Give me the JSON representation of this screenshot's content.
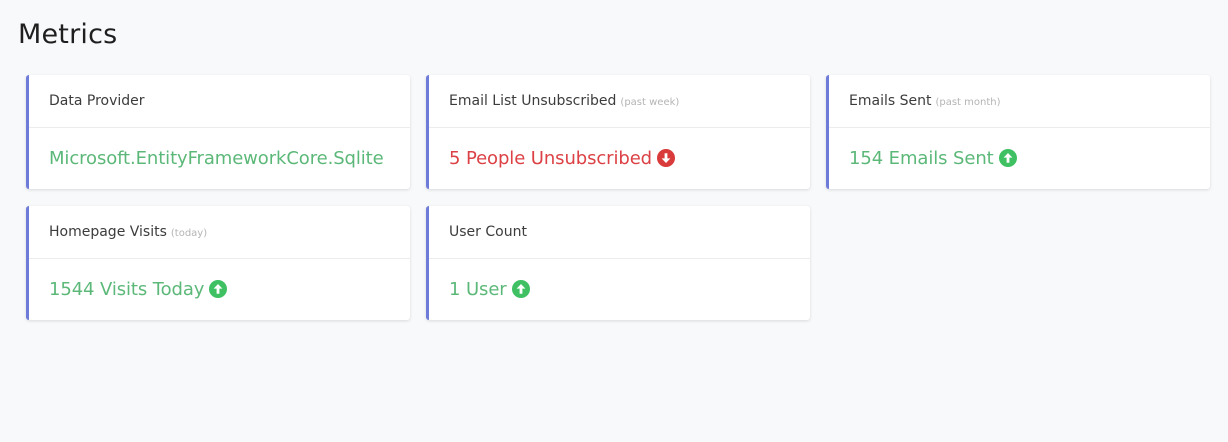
{
  "page": {
    "title": "Metrics"
  },
  "colors": {
    "accent_border": "#6e7bd9",
    "positive": "#5cb879",
    "negative": "#dc4145",
    "icon_up": "#3ec063",
    "icon_down": "#d93a3a",
    "background": "#f8f9fb"
  },
  "cards": [
    {
      "title": "Data Provider",
      "subtitle": "",
      "value": "Microsoft.EntityFrameworkCore.Sqlite",
      "trend": "none"
    },
    {
      "title": "Email List Unsubscribed",
      "subtitle": "(past week)",
      "value": "5 People Unsubscribed",
      "trend": "down",
      "icon": "arrow-down-circle-icon"
    },
    {
      "title": "Emails Sent",
      "subtitle": "(past month)",
      "value": "154 Emails Sent",
      "trend": "up",
      "icon": "arrow-up-circle-icon"
    },
    {
      "title": "Homepage Visits",
      "subtitle": "(today)",
      "value": "1544 Visits Today",
      "trend": "up",
      "icon": "arrow-up-circle-icon"
    },
    {
      "title": "User Count",
      "subtitle": "",
      "value": "1 User",
      "trend": "up",
      "icon": "arrow-up-circle-icon"
    }
  ]
}
